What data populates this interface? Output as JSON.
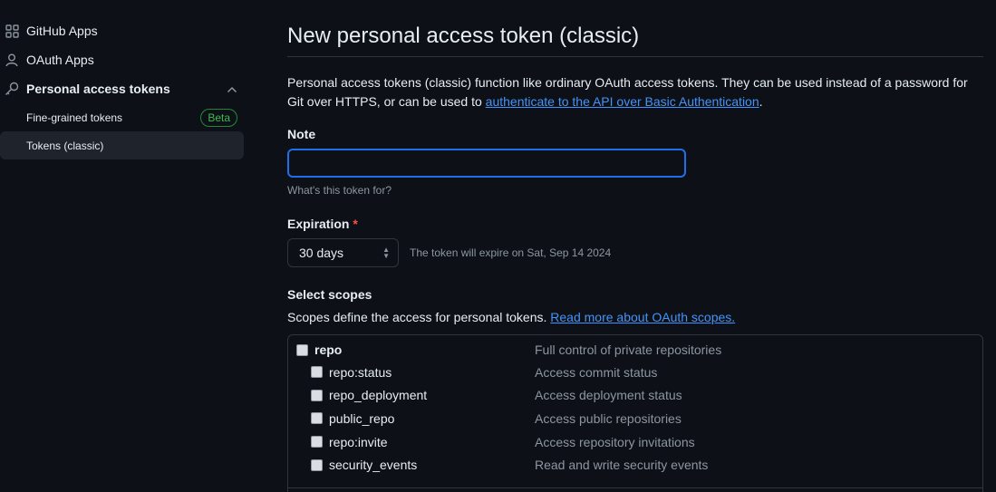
{
  "sidebar": {
    "items": [
      {
        "label": "GitHub Apps",
        "icon": "apps-grid-icon"
      },
      {
        "label": "OAuth Apps",
        "icon": "person-icon"
      },
      {
        "label": "Personal access tokens",
        "icon": "key-icon"
      }
    ],
    "subitems": [
      {
        "label": "Fine-grained tokens",
        "badge": "Beta"
      },
      {
        "label": "Tokens (classic)"
      }
    ]
  },
  "main": {
    "title": "New personal access token (classic)",
    "intro_text": "Personal access tokens (classic) function like ordinary OAuth access tokens. They can be used instead of a password for Git over HTTPS, or can be used to ",
    "intro_link": "authenticate to the API over Basic Authentication",
    "intro_end": ".",
    "note": {
      "label": "Note",
      "value": "",
      "hint": "What's this token for?"
    },
    "expiration": {
      "label": "Expiration",
      "required_mark": "*",
      "selected": "30 days",
      "note": "The token will expire on Sat, Sep 14 2024"
    },
    "scopes": {
      "label": "Select scopes",
      "description": "Scopes define the access for personal tokens. ",
      "link": "Read more about OAuth scopes.",
      "rows": [
        {
          "name": "repo",
          "desc": "Full control of private repositories"
        },
        {
          "name": "repo:status",
          "desc": "Access commit status"
        },
        {
          "name": "repo_deployment",
          "desc": "Access deployment status"
        },
        {
          "name": "public_repo",
          "desc": "Access public repositories"
        },
        {
          "name": "repo:invite",
          "desc": "Access repository invitations"
        },
        {
          "name": "security_events",
          "desc": "Read and write security events"
        }
      ]
    }
  },
  "colors": {
    "background": "#0d1117",
    "link": "#4493f8",
    "focus": "#1f6feb",
    "badge": "#3fb950",
    "required": "#f85149"
  }
}
